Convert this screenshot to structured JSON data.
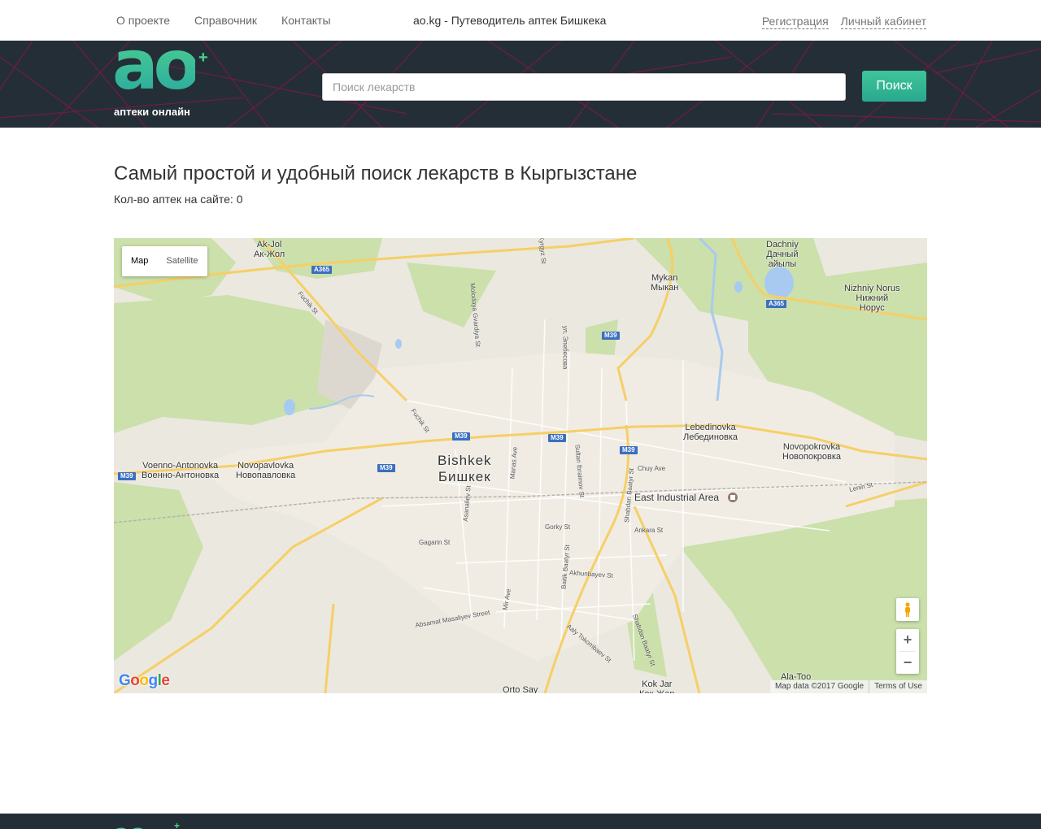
{
  "topnav": {
    "items": [
      "О проекте",
      "Справочник",
      "Контакты"
    ],
    "site_title": "ao.kg - Путеводитель аптек Бишкека",
    "register": "Регистрация",
    "cabinet": "Личный кабинет"
  },
  "header": {
    "logo_text": "ao",
    "logo_plus": "+",
    "logo_tagline": "аптеки онлайн",
    "search_placeholder": "Поиск лекарств",
    "search_button": "Поиск"
  },
  "main": {
    "title": "Самый простой и удобный поиск лекарств в Кыргызстане",
    "count_label": "Кол-во аптек на сайте:",
    "count_value": "0"
  },
  "map": {
    "type_map": "Map",
    "type_satellite": "Satellite",
    "zoom_in": "+",
    "zoom_out": "−",
    "google": "Google",
    "map_data": "Map data ©2017 Google",
    "terms": "Terms of Use",
    "labels": {
      "akjol": "Ak-Jol\nАк-Жол",
      "dachniy": "Dachniy\nДачный\nайылы",
      "mykan": "Mykan\nМыкан",
      "nizhniy": "Nizhniy Norus\nНижний\nНорус",
      "voenno": "Voenno-Antonovka\nВоенно-Антоновка",
      "novopavlovka": "Novopavlovka\nНовопавловка",
      "bishkek": "Bishkek\nБишкек",
      "lebedinovka": "Lebedinovka\nЛебединовка",
      "novopokrovka": "Novopokrovka\nНовопокровка",
      "east_industrial": "East Industrial Area",
      "ala_too": "Ala-Too",
      "kok_jar": "Kok Jar\nКок-Жар",
      "orto_say": "Orto Say"
    },
    "streets": {
      "fuchik1": "Fuchik St",
      "fuchik2": "Fuchik St",
      "molodaya": "Molodaya Gvardiya St",
      "kyrgyz": "Kyrgyz St",
      "elebesova": "ул. Элебесова",
      "manas": "Manas Ave",
      "sultan": "Sultan Ibraimov St",
      "shabdan1": "Shabdan Baatyr St",
      "chuy": "Chuy Ave",
      "lenin": "Lenin St",
      "ankara": "Ankara St",
      "gorky": "Gorky St",
      "asanaliev": "Asanaliev St",
      "gagarin": "Gagarin St",
      "baitik": "Baitik Baatyr St",
      "akhunbayev": "Akhunbayev St",
      "mir": "Mir Ave",
      "masaliyev": "Absamat Masaliyev Street",
      "tokombaev": "Aaly Tokombaev St",
      "shabdan2": "Shabdan Baatyr St"
    },
    "shields": {
      "a365_1": "A365",
      "a365_2": "A365",
      "m39_1": "M39",
      "m39_2": "M39",
      "m39_3": "M39",
      "m39_4": "M39",
      "m39_5": "M39",
      "m39_6": "M39"
    }
  },
  "colors": {
    "header_bg": "#242e37",
    "accent_green": "#3ec59a",
    "pattern_line": "#8a1d4a",
    "highway": "#f9d16c",
    "green_area": "#c8dfa7",
    "water": "#a4c8f0"
  }
}
